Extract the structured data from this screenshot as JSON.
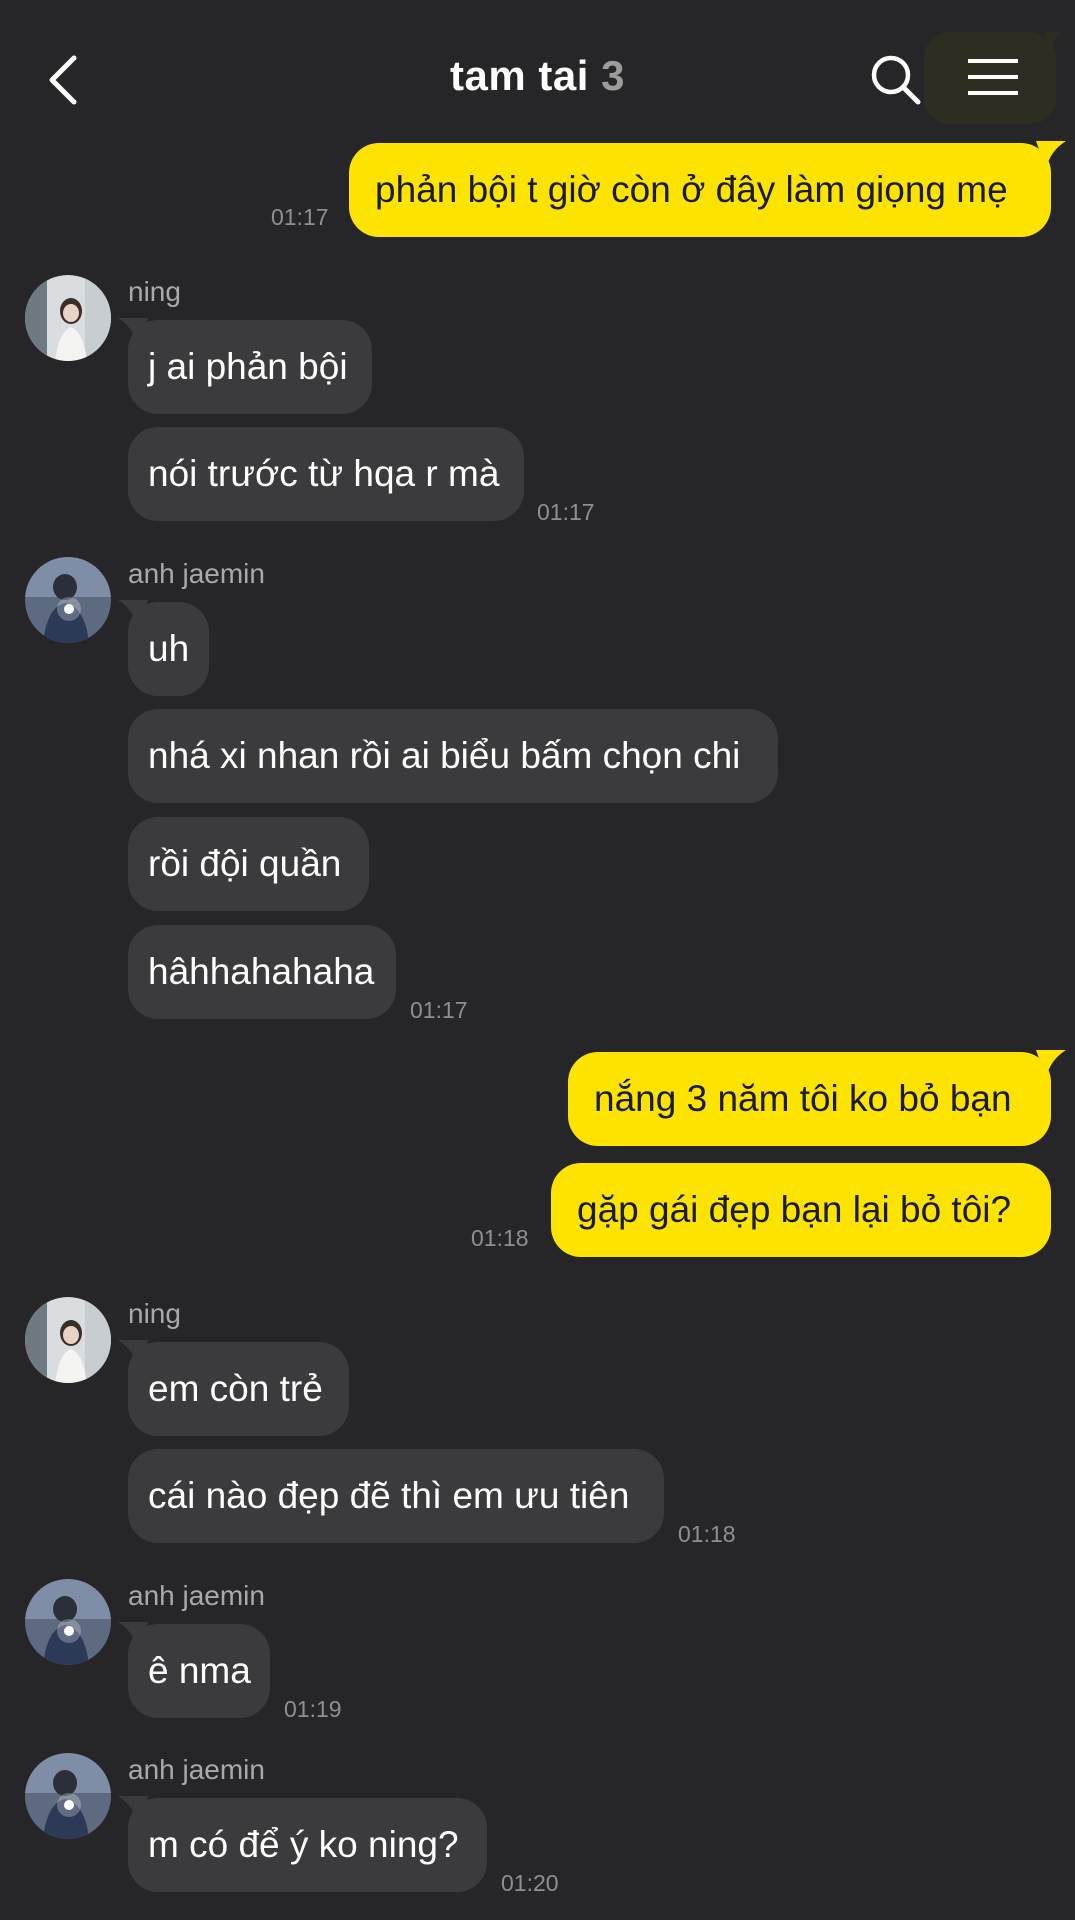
{
  "header": {
    "title": "tam tai",
    "member_count": "3",
    "icons": [
      "back-arrow-icon",
      "search-icon",
      "menu-icon"
    ]
  },
  "colors": {
    "background": "#262628",
    "incoming_bubble": "#3b3b3d",
    "outgoing_bubble": "#fde300",
    "timestamp": "#8f8f91"
  },
  "messages": [
    {
      "sender": "me",
      "text": "phản bội t giờ còn ở đây làm giọng mẹ",
      "time": "01:17"
    },
    {
      "sender": "ning",
      "text": "j ai phản bội"
    },
    {
      "sender": "ning",
      "text": "nói trước từ hqa r mà",
      "time": "01:17"
    },
    {
      "sender": "anh jaemin",
      "text": "uh"
    },
    {
      "sender": "anh jaemin",
      "text": "nhá xi nhan rồi ai biểu bấm chọn chi"
    },
    {
      "sender": "anh jaemin",
      "text": "rồi đội quần"
    },
    {
      "sender": "anh jaemin",
      "text": "hâhhahahaha",
      "time": "01:17"
    },
    {
      "sender": "me",
      "text": "nắng 3 năm tôi ko bỏ bạn"
    },
    {
      "sender": "me",
      "text": "gặp gái đẹp bạn lại bỏ tôi?",
      "time": "01:18"
    },
    {
      "sender": "ning",
      "text": "em còn trẻ"
    },
    {
      "sender": "ning",
      "text": "cái nào đẹp đẽ thì em ưu tiên",
      "time": "01:18"
    },
    {
      "sender": "anh jaemin",
      "text": "ê nma",
      "time": "01:19"
    },
    {
      "sender": "anh jaemin",
      "text": "m có để ý ko ning?",
      "time": "01:20"
    }
  ],
  "sender_labels": {
    "ning_1": "ning",
    "jaemin_1": "anh jaemin",
    "ning_2": "ning",
    "jaemin_2": "anh jaemin",
    "jaemin_3": "anh jaemin"
  }
}
